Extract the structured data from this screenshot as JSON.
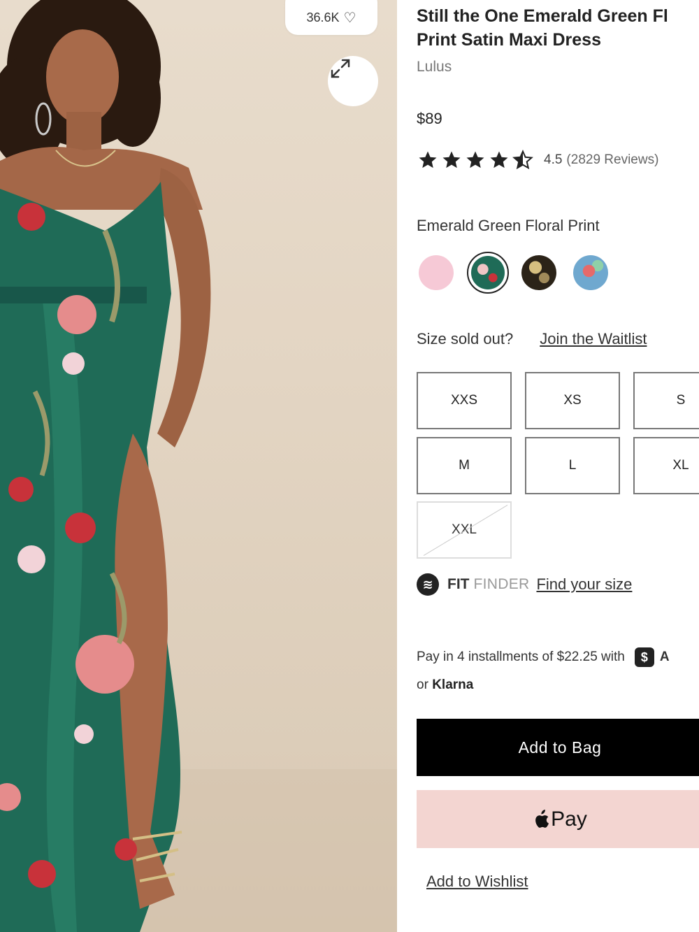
{
  "gallery": {
    "likes": "36.6K",
    "heart_icon": "heart-outline-icon",
    "expand_icon": "expand-arrows-icon"
  },
  "product": {
    "title_line1": "Still the One Emerald Green Fl",
    "title_line2": "Print Satin Maxi Dress",
    "brand": "Lulus",
    "price": "$89",
    "rating_value": "4.5",
    "rating_count": "(2829 Reviews)",
    "rating_stars": 4.5
  },
  "color": {
    "selected_name": "Emerald Green Floral Print",
    "swatches": [
      {
        "name": "pink",
        "color": "#f6c9d6"
      },
      {
        "name": "emerald-floral",
        "color": "#1f6b57"
      },
      {
        "name": "black-gold-floral",
        "color": "#5a4a30"
      },
      {
        "name": "blue-pink-floral",
        "color": "#7fb0c9"
      }
    ]
  },
  "sizes": {
    "sold_out_label": "Size sold out?",
    "waitlist_link": "Join the Waitlist",
    "options": [
      "XXS",
      "XS",
      "S",
      "M",
      "L",
      "XL",
      "XXL"
    ]
  },
  "fit_finder": {
    "logo_glyph": "≋",
    "label_bold": "FIT",
    "label_light": "FINDER",
    "link": "Find your size"
  },
  "payment": {
    "installments_text": "Pay in 4 installments of $22.25 with",
    "cash_icon": "$",
    "cash_partial": "A",
    "klarna_prefix": "or",
    "klarna_brand": "Klarna",
    "add_to_bag": "Add to Bag",
    "apple_pay_label": "Pay",
    "wishlist": "Add to Wishlist"
  },
  "colors": {
    "button_black": "#000000",
    "apple_pay_bg": "#f3d5d1",
    "dress_green": "#1f6b57"
  }
}
